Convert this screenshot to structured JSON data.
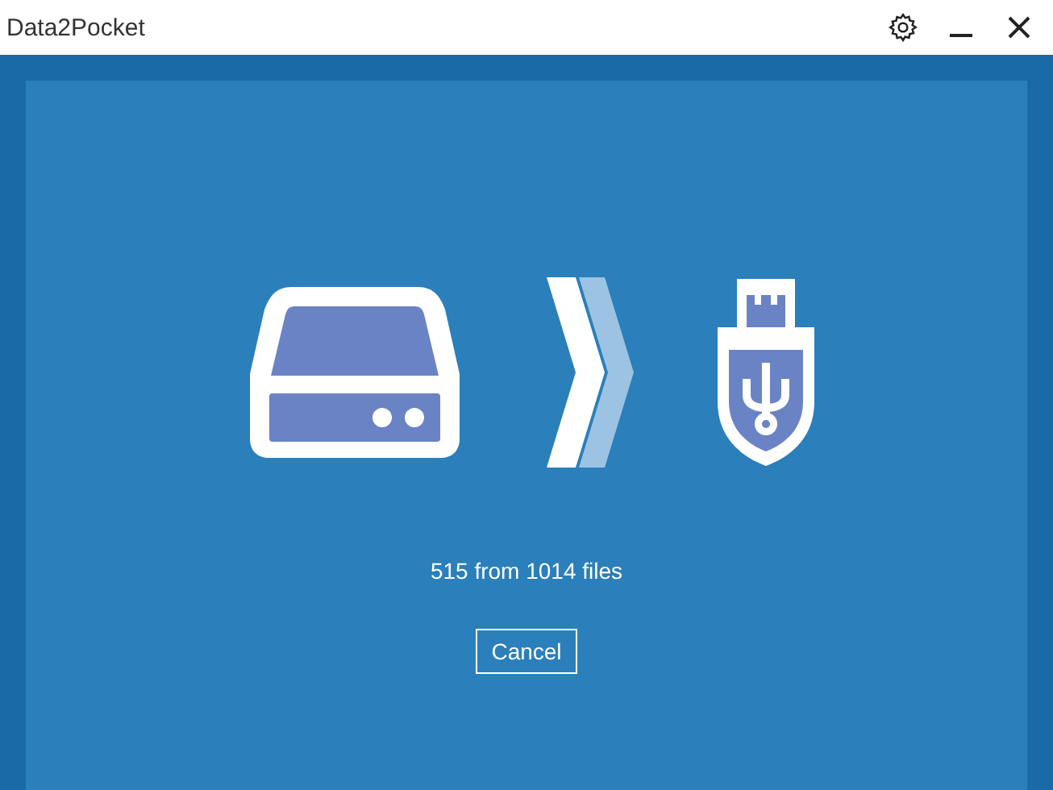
{
  "window": {
    "title": "Data2Pocket"
  },
  "progress": {
    "text": "515 from 1014 files"
  },
  "buttons": [
    {
      "label": "Cancel"
    }
  ]
}
